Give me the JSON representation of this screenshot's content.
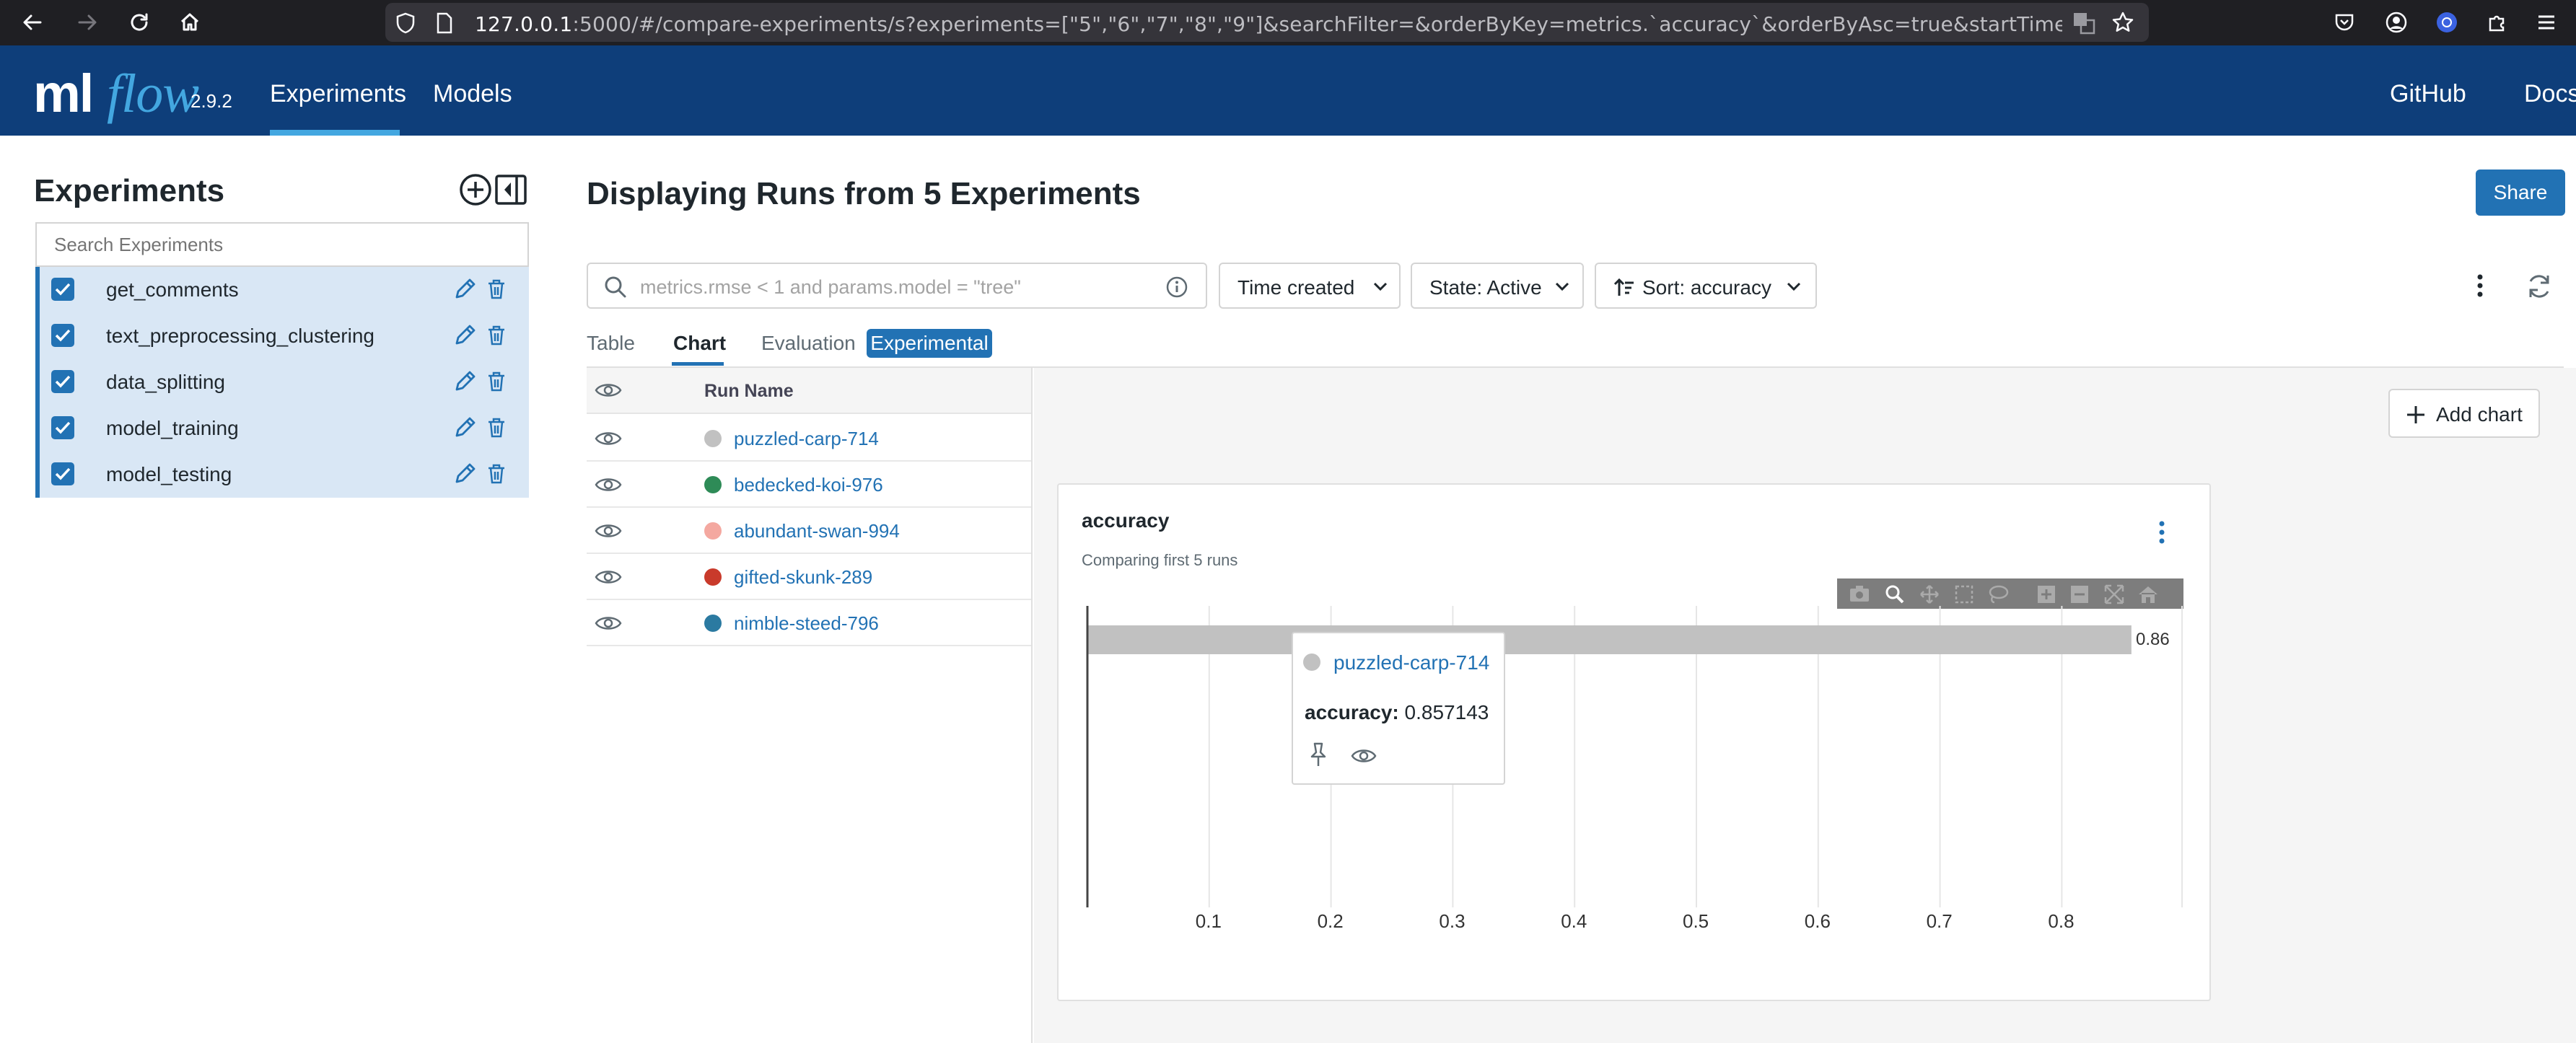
{
  "browser": {
    "url_host": "127.0.0.1",
    "url_rest": ":5000/#/compare-experiments/s?experiments=[\"5\",\"6\",\"7\",\"8\",\"9\"]&searchFilter=&orderByKey=metrics.`accuracy`&orderByAsc=true&startTime=ALL&lifecycleFilter="
  },
  "header": {
    "logo_ml": "ml",
    "logo_flow": "flow",
    "version": "2.9.2",
    "nav": {
      "experiments": "Experiments",
      "models": "Models",
      "github": "GitHub",
      "docs": "Docs"
    },
    "colors": {
      "header_bg": "#0e3e7a",
      "accent": "#43a7e0"
    }
  },
  "sidebar": {
    "title": "Experiments",
    "search_placeholder": "Search Experiments",
    "experiments": [
      {
        "label": "get_comments",
        "checked": true
      },
      {
        "label": "text_preprocessing_clustering",
        "checked": true
      },
      {
        "label": "data_splitting",
        "checked": true
      },
      {
        "label": "model_training",
        "checked": true
      },
      {
        "label": "model_testing",
        "checked": true
      }
    ]
  },
  "main": {
    "title": "Displaying Runs from 5 Experiments",
    "share_label": "Share",
    "filter_placeholder": "metrics.rmse < 1 and params.model = \"tree\"",
    "time_created_label": "Time created",
    "state_label": "State: Active",
    "sort_label": "Sort: accuracy",
    "tabs": {
      "table": "Table",
      "chart": "Chart",
      "evaluation": "Evaluation",
      "experimental": "Experimental"
    },
    "active_tab": "Chart",
    "brand_color": "#2272b4"
  },
  "runs": {
    "header": "Run Name",
    "rows": [
      {
        "name": "puzzled-carp-714",
        "color": "#c1c1c1"
      },
      {
        "name": "bedecked-koi-976",
        "color": "#2e8b57"
      },
      {
        "name": "abundant-swan-994",
        "color": "#f4a8a0"
      },
      {
        "name": "gifted-skunk-289",
        "color": "#c93a2b"
      },
      {
        "name": "nimble-steed-796",
        "color": "#2b7aa1"
      }
    ]
  },
  "chart": {
    "add_chart_label": "Add chart",
    "title": "accuracy",
    "subtitle": "Comparing first 5 runs",
    "bar_label": "0.86",
    "tooltip": {
      "run": "puzzled-carp-714",
      "metric_name": "accuracy:",
      "metric_value": "0.857143"
    }
  },
  "chart_data": {
    "type": "bar",
    "orientation": "horizontal",
    "title": "accuracy",
    "subtitle": "Comparing first 5 runs",
    "categories": [
      "puzzled-carp-714"
    ],
    "values": [
      0.857143
    ],
    "data_labels": [
      "0.86"
    ],
    "bar_color": "#c1c1c1",
    "xlim": [
      0,
      0.9
    ],
    "xticks": [
      0.1,
      0.2,
      0.3,
      0.4,
      0.5,
      0.6,
      0.7,
      0.8
    ],
    "grid": true
  }
}
